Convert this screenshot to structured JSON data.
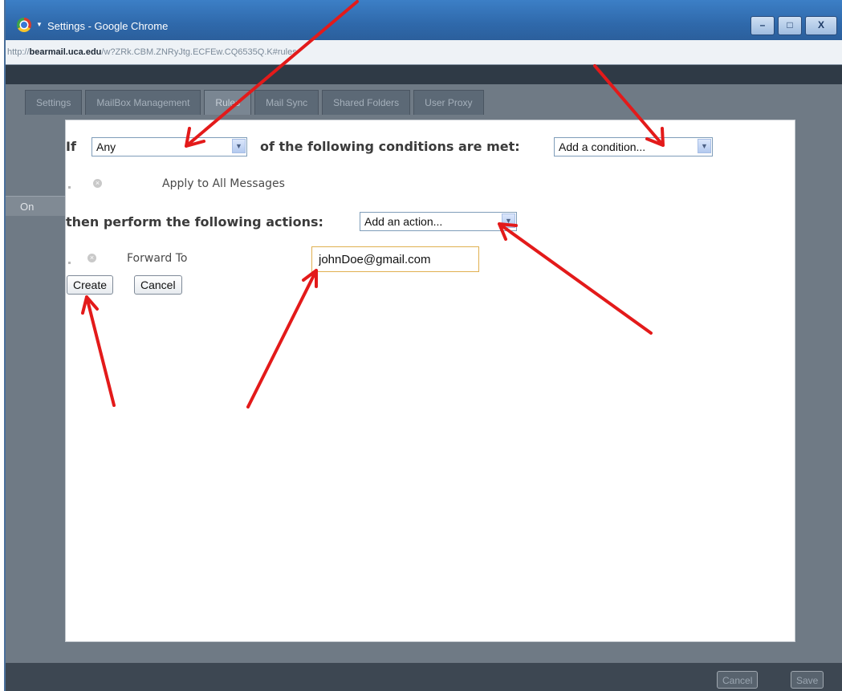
{
  "window": {
    "title": "Settings - Google Chrome",
    "url_prefix": "http://",
    "url_domain": "bearmail.uca.edu",
    "url_path": "/w?ZRk.CBM.ZNRyJtg.ECFEw.CQ6535Q.K#rules",
    "controls": {
      "minimize": "–",
      "maximize": "□",
      "close": "X"
    }
  },
  "tabs": [
    {
      "label": "Settings"
    },
    {
      "label": "MailBox Management"
    },
    {
      "label": "Rules"
    },
    {
      "label": "Mail Sync"
    },
    {
      "label": "Shared Folders"
    },
    {
      "label": "User Proxy"
    }
  ],
  "background": {
    "side_label": "On",
    "cancel_label": "Cancel",
    "save_label": "Save"
  },
  "rule_dialog": {
    "if_label": "If",
    "match_select_value": "Any",
    "conditions_text": "of the following conditions are met:",
    "condition_select_value": "Add a condition...",
    "condition_item": "Apply to All Messages",
    "actions_text": "then perform the following actions:",
    "action_select_value": "Add an action...",
    "action_item_label": "Forward To",
    "forward_address": "johnDoe@gmail.com",
    "create_label": "Create",
    "cancel_label": "Cancel"
  },
  "colors": {
    "annotation_arrow": "#e31a1a",
    "title_bar": "#2f69ab",
    "input_focus_border": "#e0b050"
  },
  "icons": [
    "chrome-logo-icon",
    "remove-icon",
    "chevron-down-icon",
    "annotation-arrow"
  ]
}
